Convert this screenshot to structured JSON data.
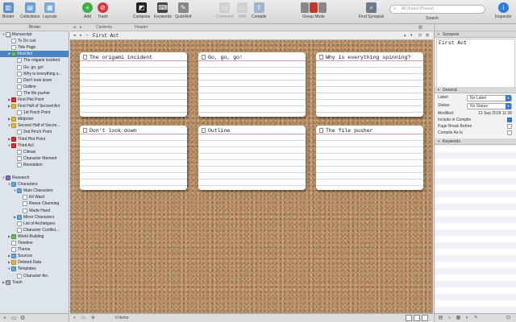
{
  "toolbar": {
    "binder": "Binder",
    "collections": "Collections",
    "layouts": "Layouts",
    "add": "Add",
    "trash": "Trash",
    "compose": "Compose",
    "keywords": "Keywords",
    "quickref": "QuickRef",
    "comment": "Comment",
    "wiki": "Wiki",
    "compile": "Compile",
    "group_mode": "Group Mode",
    "find_synopsis": "Find Synopsis",
    "search_placeholder": "All (Exact Phrase)",
    "search": "Search",
    "inspector": "Inspector"
  },
  "binder": {
    "header": "Binder",
    "items": [
      {
        "label": "Manuscript",
        "depth": 0,
        "tri": "▼",
        "icon": "ico-doc-stack"
      },
      {
        "label": "To Do List",
        "depth": 1,
        "tri": "",
        "icon": "ico-doc"
      },
      {
        "label": "Title Page",
        "depth": 1,
        "tri": "",
        "icon": "ico-doc"
      },
      {
        "label": "First Act",
        "depth": 1,
        "tri": "▼",
        "icon": "ico-folder-green",
        "selected": true
      },
      {
        "label": "The origami incident",
        "depth": 2,
        "tri": "",
        "icon": "ico-doc"
      },
      {
        "label": "Go, go, go!",
        "depth": 2,
        "tri": "",
        "icon": "ico-doc"
      },
      {
        "label": "Why is everything s...",
        "depth": 2,
        "tri": "",
        "icon": "ico-doc"
      },
      {
        "label": "Don't look down",
        "depth": 2,
        "tri": "",
        "icon": "ico-doc"
      },
      {
        "label": "Outline",
        "depth": 2,
        "tri": "",
        "icon": "ico-doc"
      },
      {
        "label": "The file pusher",
        "depth": 2,
        "tri": "",
        "icon": "ico-doc"
      },
      {
        "label": "First Plot Point",
        "depth": 1,
        "tri": "▶",
        "icon": "ico-flag-red"
      },
      {
        "label": "First Half of Second Act",
        "depth": 1,
        "tri": "▶",
        "icon": "ico-flag-yellow"
      },
      {
        "label": "1st Pinch Point",
        "depth": 2,
        "tri": "",
        "icon": "ico-doc"
      },
      {
        "label": "Midpoint",
        "depth": 1,
        "tri": "▶",
        "icon": "ico-flag-yellow"
      },
      {
        "label": "Second Half of Secon...",
        "depth": 1,
        "tri": "▼",
        "icon": "ico-flag-yellow"
      },
      {
        "label": "2nd Pinch Point",
        "depth": 2,
        "tri": "",
        "icon": "ico-doc"
      },
      {
        "label": "Third Plot Point",
        "depth": 1,
        "tri": "▶",
        "icon": "ico-flag-red"
      },
      {
        "label": "Third Act",
        "depth": 1,
        "tri": "▼",
        "icon": "ico-flag-red"
      },
      {
        "label": "Climax",
        "depth": 2,
        "tri": "",
        "icon": "ico-doc"
      },
      {
        "label": "Character Moment",
        "depth": 2,
        "tri": "",
        "icon": "ico-doc"
      },
      {
        "label": "Resolution",
        "depth": 2,
        "tri": "",
        "icon": "ico-doc"
      },
      {
        "label": "",
        "depth": 0,
        "tri": "",
        "icon": ""
      },
      {
        "label": "Research",
        "depth": 0,
        "tri": "▼",
        "icon": "ico-research"
      },
      {
        "label": "Characters",
        "depth": 1,
        "tri": "▼",
        "icon": "ico-folder"
      },
      {
        "label": "Main Characters",
        "depth": 2,
        "tri": "▼",
        "icon": "ico-folder"
      },
      {
        "label": "Kit Ward",
        "depth": 3,
        "tri": "",
        "icon": "ico-doc"
      },
      {
        "label": "Reese Channing",
        "depth": 3,
        "tri": "",
        "icon": "ico-doc"
      },
      {
        "label": "Wade Hand",
        "depth": 3,
        "tri": "",
        "icon": "ico-doc"
      },
      {
        "label": "Minor Characters",
        "depth": 2,
        "tri": "▶",
        "icon": "ico-folder"
      },
      {
        "label": "List of Archetypes",
        "depth": 2,
        "tri": "",
        "icon": "ico-doc"
      },
      {
        "label": "Character Conflict...",
        "depth": 2,
        "tri": "",
        "icon": "ico-doc"
      },
      {
        "label": "World-Building",
        "depth": 1,
        "tri": "▶",
        "icon": "ico-folder-green"
      },
      {
        "label": "Timeline",
        "depth": 1,
        "tri": "",
        "icon": "ico-doc"
      },
      {
        "label": "Theme",
        "depth": 1,
        "tri": "",
        "icon": "ico-doc"
      },
      {
        "label": "Sources",
        "depth": 1,
        "tri": "▶",
        "icon": "ico-folder"
      },
      {
        "label": "Deleted Data",
        "depth": 1,
        "tri": "▶",
        "icon": "ico-flag-yellow"
      },
      {
        "label": "Templates",
        "depth": 1,
        "tri": "▼",
        "icon": "ico-folder"
      },
      {
        "label": "Character Arc",
        "depth": 2,
        "tri": "",
        "icon": "ico-doc"
      },
      {
        "label": "Trash",
        "depth": 0,
        "tri": "▶",
        "icon": "ico-trash"
      }
    ]
  },
  "editor": {
    "title": "First Act",
    "nav_left": "Contents",
    "nav_right": "Header",
    "item_count": "6 Items"
  },
  "cards": [
    {
      "title": "The origami incident"
    },
    {
      "title": "Go, go, go!"
    },
    {
      "title": "Why is everything spinning?"
    },
    {
      "title": "Don't look down"
    },
    {
      "title": "Outline"
    },
    {
      "title": "The file pusher"
    }
  ],
  "inspector": {
    "synopsis_header": "Synopsis",
    "synopsis_text": "First Act",
    "general_header": "General",
    "label_label": "Label:",
    "label_value": "No Label",
    "status_label": "Status:",
    "status_value": "No Status",
    "modified_label": "Modified:",
    "modified_value": "13 Sep 2018 11:38",
    "include_compile": "Include in Compile",
    "page_break": "Page Break Before",
    "compile_as_is": "Compile As-Is",
    "keywords_header": "Keywords"
  },
  "colors": {
    "accent": "#4a86c7",
    "cork": "#b8916a",
    "add_green": "#3eb046",
    "trash_red": "#d9363e"
  }
}
